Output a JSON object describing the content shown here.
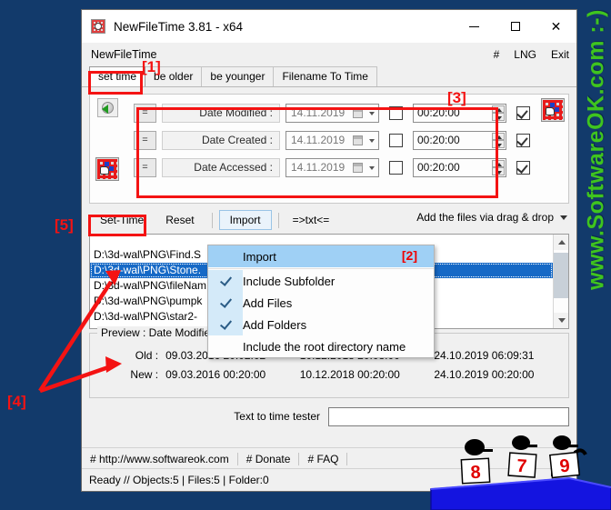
{
  "watermark": {
    "text": "www.SoftwareOK.com  :-)",
    "color": "#3fc41f",
    "background": "#123a6b"
  },
  "window": {
    "title": "NewFileTime 3.81 - x64",
    "title_icon": "calendar-clock-icon",
    "buttons": {
      "minimize": "–",
      "maximize": "□",
      "close": "✕"
    }
  },
  "menu": {
    "app_name": "NewFileTime",
    "hash": "#",
    "language": "LNG",
    "exit": "Exit"
  },
  "tabs": [
    {
      "label": "set time",
      "active": true
    },
    {
      "label": "be older",
      "active": false
    },
    {
      "label": "be younger",
      "active": false
    },
    {
      "label": "Filename To Time",
      "active": false
    }
  ],
  "fields": {
    "refresh_icon": "refresh-globe-icon",
    "left_grid_icon": "grid-cursor-icon",
    "right_grid_icon": "grid-cursor-icon",
    "rows": [
      {
        "equals_label": "=",
        "label": "Date Modified :",
        "date_value": "14.11.2019",
        "date_checkbox_checked": false,
        "time_value": "00:20:00",
        "time_checkbox_checked": true
      },
      {
        "equals_label": "=",
        "label": "Date Created :",
        "date_value": "14.11.2019",
        "date_checkbox_checked": false,
        "time_value": "00:20:00",
        "time_checkbox_checked": true
      },
      {
        "equals_label": "=",
        "label": "Date Accessed :",
        "date_value": "14.11.2019",
        "date_checkbox_checked": false,
        "time_value": "00:20:00",
        "time_checkbox_checked": true
      }
    ]
  },
  "actions": {
    "set_time": "Set-Time",
    "reset": "Reset",
    "import": "Import",
    "txt": "=>txt<=",
    "drag_drop": "Add the files via drag & drop"
  },
  "file_list": [
    {
      "path": "D:\\3d-wal\\PNG\\Find.S",
      "selected": false
    },
    {
      "path": "D:\\3d-wal\\PNG\\Stone.",
      "selected": true
    },
    {
      "path": "D:\\3d-wal\\PNG\\fileNam",
      "selected": false
    },
    {
      "path": "D:\\3d-wal\\PNG\\pumpk",
      "selected": false
    },
    {
      "path": "D:\\3d-wal\\PNG\\star2-",
      "selected": false
    }
  ],
  "dropdown": {
    "marker": "[2]",
    "items": [
      {
        "label": "Import",
        "checked": false,
        "highlighted": true
      },
      {
        "label": "Include Subfolder",
        "checked": true,
        "highlighted": false
      },
      {
        "label": "Add Files",
        "checked": true,
        "highlighted": false
      },
      {
        "label": "Add Folders",
        "checked": true,
        "highlighted": false
      },
      {
        "label": "Include the root directory name",
        "checked": false,
        "highlighted": false
      }
    ]
  },
  "preview": {
    "legend": "Preview :    Date Modified",
    "old_key": "Old :",
    "new_key": "New :",
    "old_values": [
      "09.03.2016 20:02:02",
      "10.12.2018 20:08:00",
      "24.10.2019 06:09:31"
    ],
    "new_values": [
      "09.03.2016 00:20:00",
      "10.12.2018 00:20:00",
      "24.10.2019 00:20:00"
    ]
  },
  "tester": {
    "label": "Text to time tester",
    "value": "",
    "placeholder": ""
  },
  "links": [
    {
      "label": "# http://www.softwareok.com"
    },
    {
      "label": "# Donate"
    },
    {
      "label": "# FAQ"
    }
  ],
  "status": {
    "text": "Ready // Objects:5 | Files:5  | Folder:0"
  },
  "annotations": {
    "m1": "[1]",
    "m2": "[2]",
    "m3": "[3]",
    "m4": "[4]",
    "m5": "[5]",
    "color": "#f41313"
  },
  "cartoon": {
    "signs": [
      "8",
      "7",
      "9"
    ],
    "desk_color": "#1414e0"
  }
}
